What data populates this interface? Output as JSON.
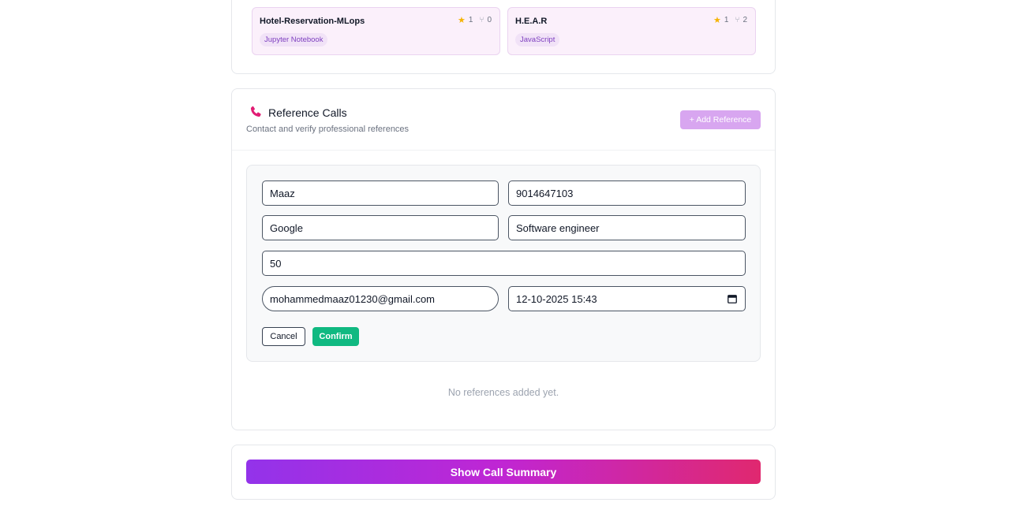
{
  "repos": [
    {
      "name": "Hotel-Reservation-MLops",
      "stars": "1",
      "forks": "0",
      "language": "Jupyter Notebook"
    },
    {
      "name": "H.E.A.R",
      "stars": "1",
      "forks": "2",
      "language": "JavaScript"
    }
  ],
  "references": {
    "title": "Reference Calls",
    "subtitle": "Contact and verify professional references",
    "add_button": "+ Add Reference",
    "form": {
      "name": "Maaz",
      "phone": "9014647103",
      "company": "Google",
      "role": "Software engineer",
      "field5": "50",
      "email": "mohammedmaaz01230@gmail.com",
      "datetime": "12-10-2025 15:43"
    },
    "cancel_label": "Cancel",
    "confirm_label": "Confirm",
    "empty_text": "No references added yet."
  },
  "summary_button": "Show Call Summary",
  "colors": {
    "accent_purple": "#9333ea",
    "accent_pink": "#e0286f",
    "confirm_green": "#10b981",
    "add_button": "#d8a6f0",
    "phone_icon": "#e11d74",
    "star": "#f5b301"
  },
  "icons": [
    "star-icon",
    "fork-icon",
    "phone-icon",
    "calendar-icon"
  ]
}
